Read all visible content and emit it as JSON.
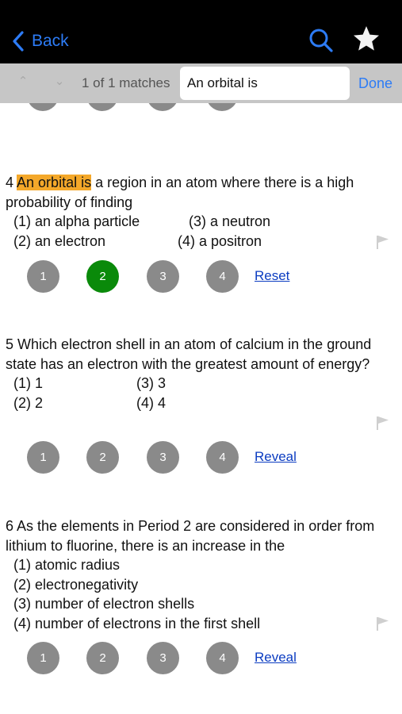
{
  "nav": {
    "back_label": "Back",
    "accent": "#2d7cf6"
  },
  "find": {
    "matches_text": "1 of 1 matches",
    "query": "An orbital is",
    "done_label": "Done"
  },
  "questions": [
    {
      "number": "4",
      "highlight": "An orbital is",
      "text_rest": " a region in an atom where there is a high probability of finding",
      "options": [
        "(1) an alpha particle",
        "(2) an electron",
        "(3) a neutron",
        "(4) a positron"
      ],
      "answers": [
        "1",
        "2",
        "3",
        "4"
      ],
      "selected": "2",
      "action_label": "Reset"
    },
    {
      "number": "5",
      "text": "5 Which electron shell in an atom of calcium in the ground state has an electron with the greatest amount of energy?",
      "options": [
        "(1) 1",
        "(2) 2",
        "(3) 3",
        "(4) 4"
      ],
      "answers": [
        "1",
        "2",
        "3",
        "4"
      ],
      "action_label": "Reveal"
    },
    {
      "number": "6",
      "text": "6 As the elements in Period 2 are considered in order from lithium to fluorine, there is an increase in the",
      "options": [
        "(1) atomic radius",
        "(2) electronegativity",
        "(3) number of electron shells",
        "(4) number of electrons in the first shell"
      ],
      "answers": [
        "1",
        "2",
        "3",
        "4"
      ],
      "action_label": "Reveal"
    }
  ],
  "colors": {
    "selected_answer": "#0a8a0a",
    "unselected_answer": "#8a8a8a",
    "highlight": "#f4a82a",
    "link": "#0b3cc1"
  }
}
